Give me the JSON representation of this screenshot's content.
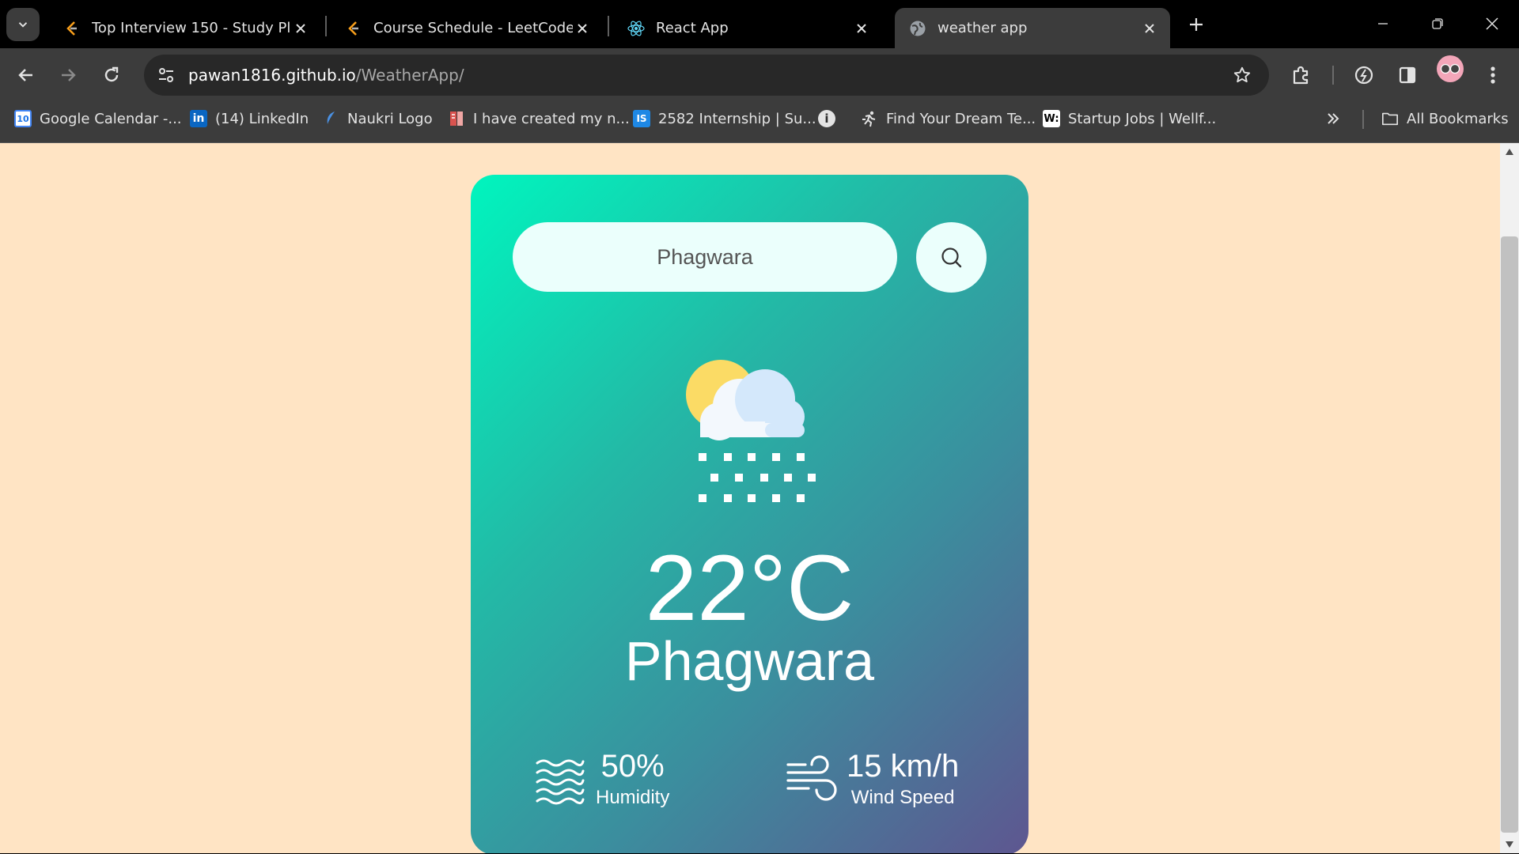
{
  "browser": {
    "tabs": [
      {
        "title": "Top Interview 150 - Study Plan",
        "favicon": "leetcode-icon"
      },
      {
        "title": "Course Schedule - LeetCode",
        "favicon": "leetcode-icon"
      },
      {
        "title": "React App",
        "favicon": "react-icon"
      },
      {
        "title": "weather app",
        "favicon": "globe-icon",
        "active": true
      }
    ],
    "address": {
      "host": "pawan1816.github.io",
      "path": "/WeatherApp/"
    },
    "bookmarks": [
      {
        "label": "Google Calendar -...",
        "icon": "google-calendar-icon"
      },
      {
        "label": "(14) LinkedIn",
        "icon": "linkedin-icon"
      },
      {
        "label": "Naukri Logo",
        "icon": "naukri-icon"
      },
      {
        "label": "I have created my n...",
        "icon": "document-icon"
      },
      {
        "label": "2582 Internship | Su...",
        "icon": "internshala-icon"
      },
      {
        "label": "",
        "icon": "info-icon"
      },
      {
        "label": "Find Your Dream Te...",
        "icon": "runner-icon"
      },
      {
        "label": "Startup Jobs | Wellf...",
        "icon": "wellfound-icon"
      }
    ],
    "all_bookmarks_label": "All Bookmarks"
  },
  "app": {
    "search": {
      "value": "Phagwara",
      "placeholder": "Search"
    },
    "weather_icon": "cloud-sun-snow-icon",
    "temperature": "22°C",
    "city": "Phagwara",
    "humidity": {
      "value": "50%",
      "label": "Humidity"
    },
    "wind": {
      "value": "15 km/h",
      "label": "Wind Speed"
    }
  },
  "colors": {
    "page_background": "#ffe4c4",
    "card_gradient_start": "#00f5be",
    "card_gradient_end": "#5e5690",
    "browser_chrome": "#3c3c3c"
  }
}
